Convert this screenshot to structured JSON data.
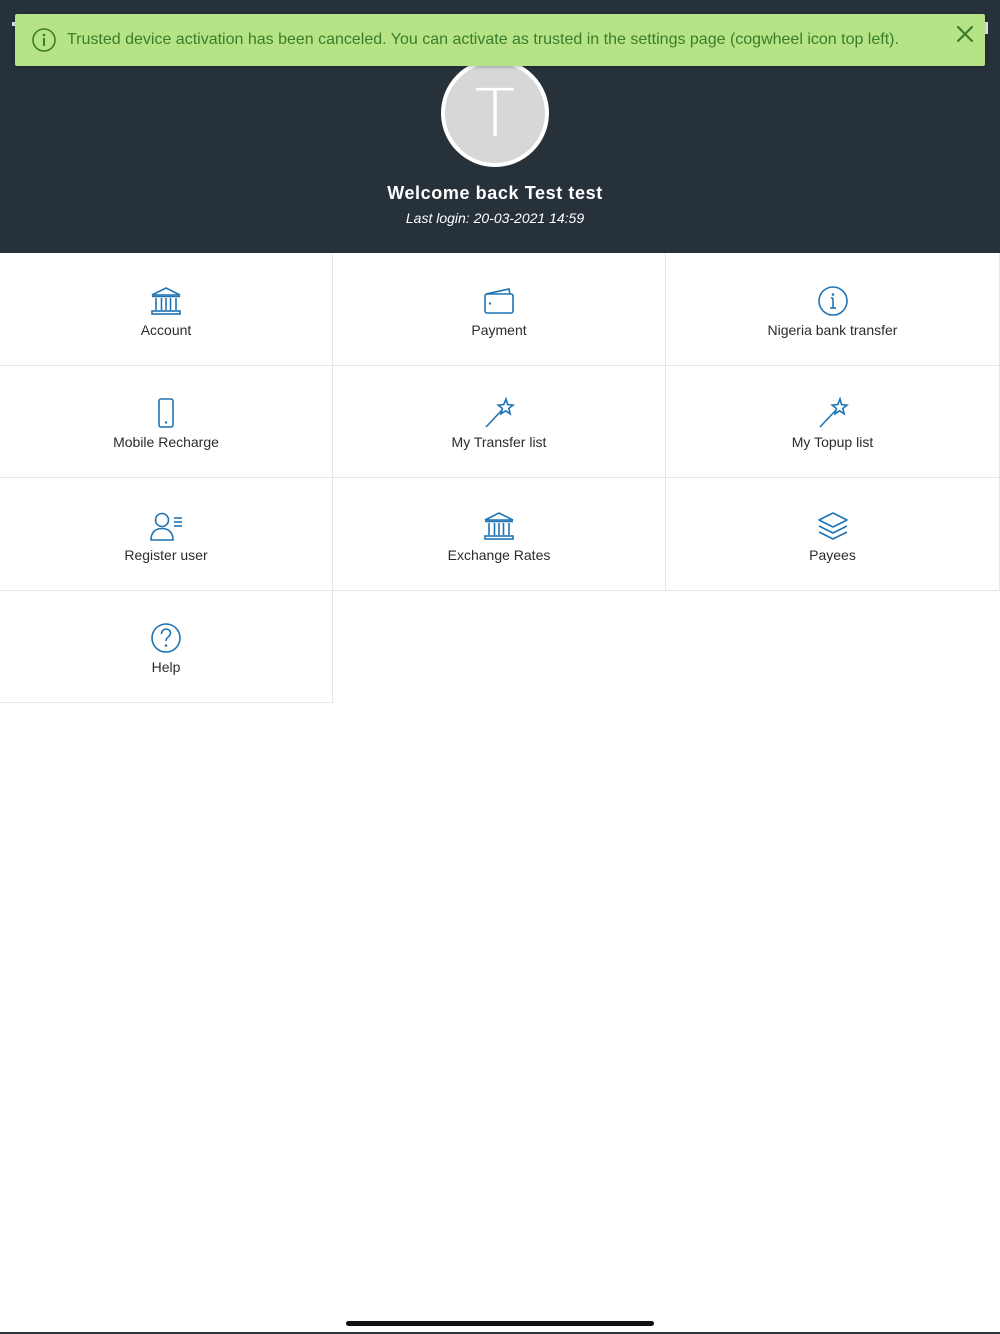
{
  "toast": {
    "message": "Trusted device activation has been canceled. You can activate as trusted in the settings page (cogwheel icon top left).",
    "info_icon": "info-circle-icon",
    "close_icon": "close-icon",
    "bg_color": "#b6e386",
    "text_color": "#3a7d2a"
  },
  "profile": {
    "avatar_letter": "T",
    "welcome": "Welcome back Test test",
    "last_login": "Last login: 20-03-2021 14:59"
  },
  "menu": {
    "accent_color": "#1e73b4",
    "items": [
      {
        "label": "Account",
        "icon": "bank-icon"
      },
      {
        "label": "Payment",
        "icon": "wallet-icon"
      },
      {
        "label": "Nigeria bank transfer",
        "icon": "info-circle-icon"
      },
      {
        "label": "Mobile Recharge",
        "icon": "mobile-phone-icon"
      },
      {
        "label": "My Transfer list",
        "icon": "magic-wand-icon"
      },
      {
        "label": "My Topup list",
        "icon": "magic-wand-icon"
      },
      {
        "label": "Register user",
        "icon": "user-list-icon"
      },
      {
        "label": "Exchange Rates",
        "icon": "bank-icon"
      },
      {
        "label": "Payees",
        "icon": "layers-icon"
      },
      {
        "label": "Help",
        "icon": "question-circle-icon"
      }
    ]
  }
}
